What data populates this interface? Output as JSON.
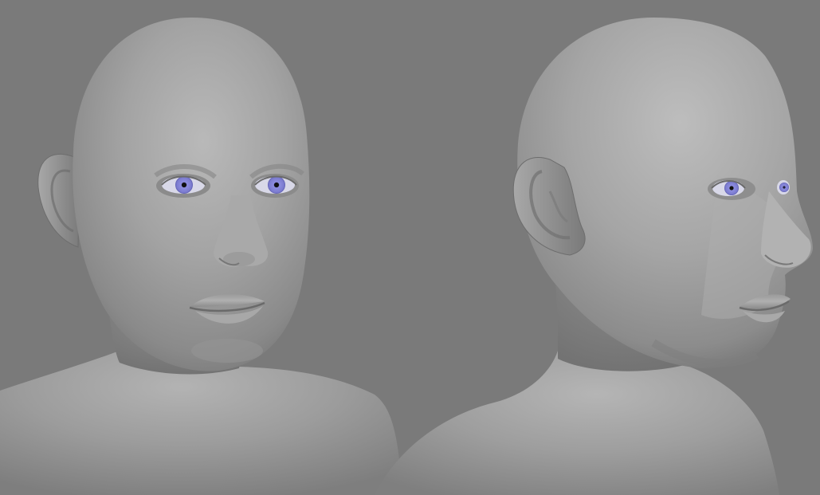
{
  "scene": {
    "background_color": "#7a7a7a",
    "skin_color": "#9a9a9a",
    "iris_color": "#8a8ad8",
    "views": [
      {
        "name": "front-three-quarter"
      },
      {
        "name": "side-profile"
      }
    ]
  }
}
